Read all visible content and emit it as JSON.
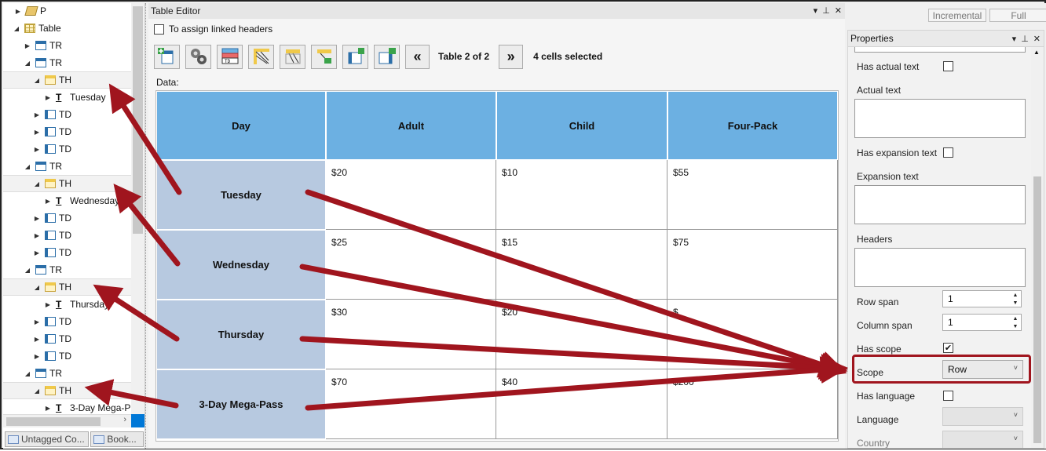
{
  "tree": {
    "items": [
      {
        "label": "P",
        "icon": "paragraph-icon",
        "expander": "right"
      },
      {
        "label": "Table",
        "icon": "table-icon",
        "expander": "down"
      },
      {
        "label": "TR",
        "icon": "table-row-icon",
        "expander": "right"
      },
      {
        "label": "TR",
        "icon": "table-row-icon",
        "expander": "down"
      },
      {
        "label": "TH",
        "icon": "table-header-cell-icon",
        "expander": "down"
      },
      {
        "label": "Tuesday",
        "icon": "text-icon",
        "expander": "right"
      },
      {
        "label": "TD",
        "icon": "table-data-cell-icon",
        "expander": "right"
      },
      {
        "label": "TD",
        "icon": "table-data-cell-icon",
        "expander": "right"
      },
      {
        "label": "TD",
        "icon": "table-data-cell-icon",
        "expander": "right"
      },
      {
        "label": "TR",
        "icon": "table-row-icon",
        "expander": "down"
      },
      {
        "label": "TH",
        "icon": "table-header-cell-icon",
        "expander": "down"
      },
      {
        "label": "Wednesday",
        "icon": "text-icon",
        "expander": "right"
      },
      {
        "label": "TD",
        "icon": "table-data-cell-icon",
        "expander": "right"
      },
      {
        "label": "TD",
        "icon": "table-data-cell-icon",
        "expander": "right"
      },
      {
        "label": "TD",
        "icon": "table-data-cell-icon",
        "expander": "right"
      },
      {
        "label": "TR",
        "icon": "table-row-icon",
        "expander": "down"
      },
      {
        "label": "TH",
        "icon": "table-header-cell-icon",
        "expander": "down"
      },
      {
        "label": "Thursday",
        "icon": "text-icon",
        "expander": "right"
      },
      {
        "label": "TD",
        "icon": "table-data-cell-icon",
        "expander": "right"
      },
      {
        "label": "TD",
        "icon": "table-data-cell-icon",
        "expander": "right"
      },
      {
        "label": "TD",
        "icon": "table-data-cell-icon",
        "expander": "right"
      },
      {
        "label": "TR",
        "icon": "table-row-icon",
        "expander": "down"
      },
      {
        "label": "TH",
        "icon": "table-header-cell-icon",
        "expander": "down"
      },
      {
        "label": "3-Day  Mega-P",
        "icon": "text-icon",
        "expander": "right"
      }
    ],
    "bottom_tabs": [
      "Untagged Co...",
      "Book..."
    ]
  },
  "editor": {
    "title": "Table Editor",
    "assign_label": "To assign linked headers",
    "table_label": "Table 2 of 2",
    "cells_selected": "4 cells selected",
    "data_label": "Data:",
    "toolbar_icons": [
      "insert-row-icon",
      "table-settings-icon",
      "header-data-toggle-icon",
      "linked-headers-icon",
      "column-header-icon",
      "row-header-icon",
      "insert-column-icon",
      "delete-column-icon"
    ],
    "prev_icon": "double-chevron-left-icon",
    "next_icon": "double-chevron-right-icon",
    "header_row": [
      "Day",
      "Adult",
      "Child",
      "Four-Pack"
    ],
    "rows": [
      {
        "header": "Tuesday",
        "cells": [
          "$20",
          "$10",
          "$55"
        ]
      },
      {
        "header": "Wednesday",
        "cells": [
          "$25",
          "$15",
          "$75"
        ]
      },
      {
        "header": "Thursday",
        "cells": [
          "$30",
          "$20",
          "$"
        ]
      },
      {
        "header": "3-Day  Mega-Pass",
        "cells": [
          "$70",
          "$40",
          "$200"
        ]
      }
    ]
  },
  "mode_buttons": {
    "incremental": "Incremental",
    "full": "Full"
  },
  "properties": {
    "title": "Properties",
    "has_actual_text": "Has actual text",
    "actual_text": "Actual text",
    "has_expansion_text": "Has expansion text",
    "expansion_text": "Expansion text",
    "headers": "Headers",
    "row_span": "Row span",
    "row_span_value": "1",
    "column_span": "Column span",
    "column_span_value": "1",
    "has_scope": "Has scope",
    "scope": "Scope",
    "scope_value": "Row",
    "has_language": "Has language",
    "language": "Language",
    "country": "Country"
  },
  "colors": {
    "highlight": "#a0151e",
    "column_header": "#6cb0e2",
    "row_header": "#b7c9e0"
  }
}
